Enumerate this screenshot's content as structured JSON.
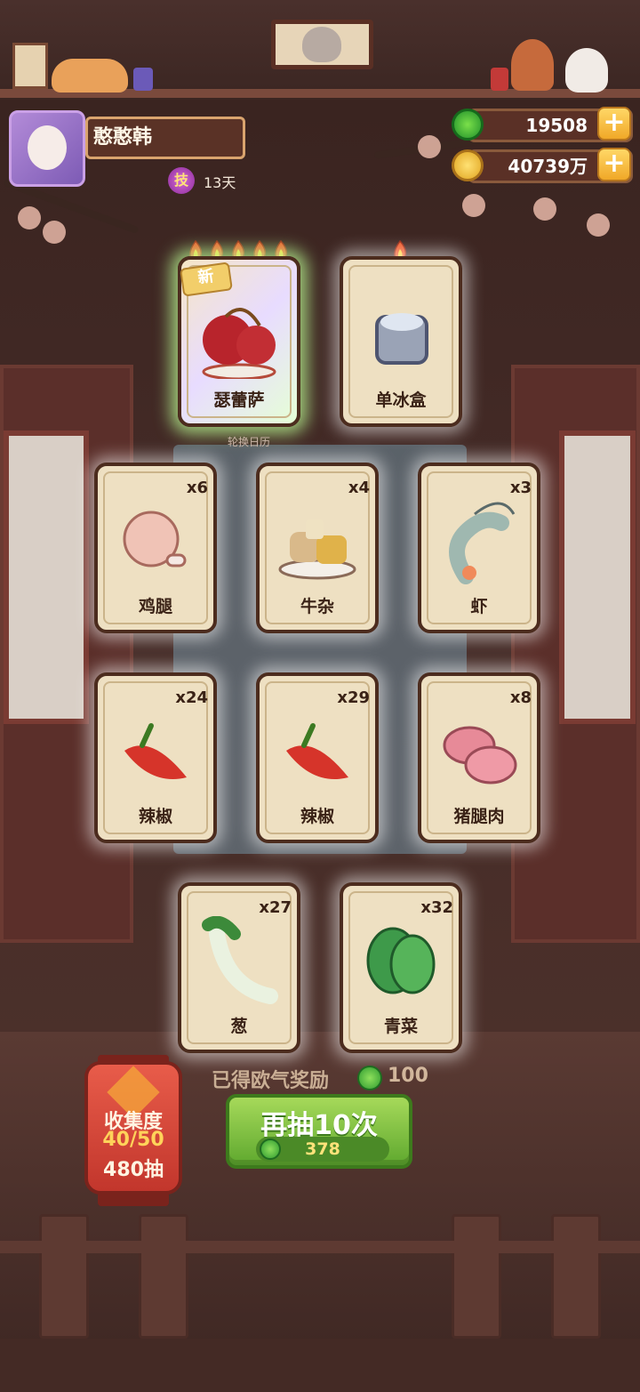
{
  "player": {
    "name": "憨憨韩",
    "skill_icon": "技",
    "skill_days": "13天"
  },
  "currency": [
    {
      "icon": "jade-coin-icon",
      "value": "19508"
    },
    {
      "icon": "gold-coin-icon",
      "value": "40739万"
    }
  ],
  "featured_cards": [
    {
      "label": "瑟蕾萨",
      "flames": 5,
      "is_new": true,
      "new_label": "新",
      "art": "cherry-tomato-icon",
      "rainbow": true
    },
    {
      "label": "单冰盒",
      "flames": 1,
      "art": "ice-box-icon"
    }
  ],
  "calendar_label": "轮换日历",
  "cards": [
    {
      "label": "鸡腿",
      "count": "x6",
      "art": "chicken-leg-icon"
    },
    {
      "label": "牛杂",
      "count": "x4",
      "art": "beef-offal-icon"
    },
    {
      "label": "虾",
      "count": "x3",
      "art": "shrimp-icon"
    },
    {
      "label": "辣椒",
      "count": "x24",
      "art": "chili-pepper-icon"
    },
    {
      "label": "辣椒",
      "count": "x29",
      "art": "chili-pepper-icon"
    },
    {
      "label": "猪腿肉",
      "count": "x8",
      "art": "pork-leg-icon"
    },
    {
      "label": "葱",
      "count": "x27",
      "art": "scallion-icon"
    },
    {
      "label": "青菜",
      "count": "x32",
      "art": "bok-choy-icon"
    }
  ],
  "reward": {
    "text": "已得欧气奖励",
    "value": "100"
  },
  "draw_button": {
    "label": "再抽10次",
    "cost": "378"
  },
  "collection": {
    "title": "收集度",
    "progress": "40/50",
    "draws": "480抽"
  }
}
